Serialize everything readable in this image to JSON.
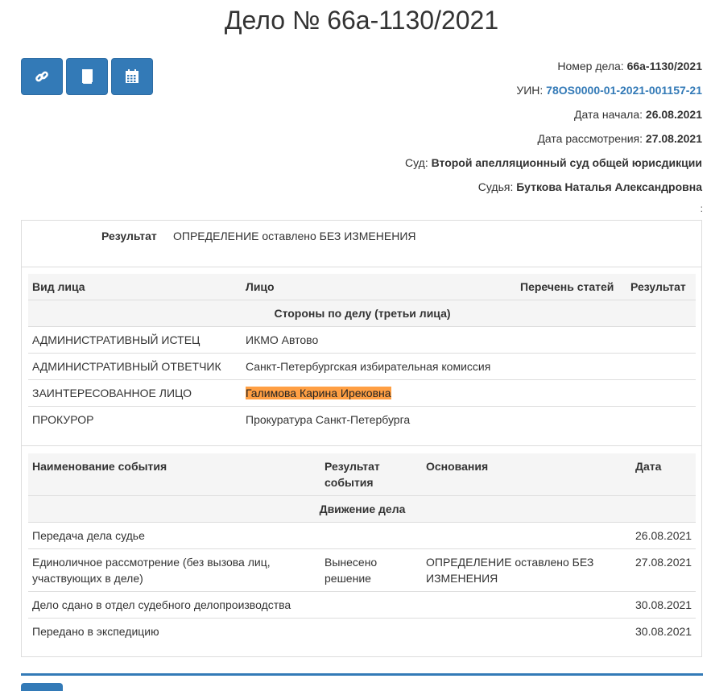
{
  "title": "Дело № 66а-1130/2021",
  "toolbar": {
    "buttons": [
      {
        "icon": "link-icon"
      },
      {
        "icon": "book-icon"
      },
      {
        "icon": "calendar-icon"
      }
    ]
  },
  "meta": {
    "case_number_label": "Номер дела:",
    "case_number": "66а-1130/2021",
    "uin_label": "УИН:",
    "uin": "78OS0000-01-2021-001157-21",
    "start_date_label": "Дата начала:",
    "start_date": "26.08.2021",
    "review_date_label": "Дата рассмотрения:",
    "review_date": "27.08.2021",
    "court_label": "Суд:",
    "court": "Второй апелляционный суд общей юрисдикции",
    "judge_label": "Судья:",
    "judge": "Буткова Наталья Александровна",
    "trailing": ":"
  },
  "result": {
    "label": "Результат",
    "value": "ОПРЕДЕЛЕНИЕ оставлено БЕЗ ИЗМЕНЕНИЯ"
  },
  "parties": {
    "caption": "Стороны по делу (третьи лица)",
    "columns": [
      "Вид лица",
      "Лицо",
      "Перечень статей",
      "Результат"
    ],
    "rows": [
      {
        "type": "АДМИНИСТРАТИВНЫЙ ИСТЕЦ",
        "person": "ИКМО Автово",
        "articles": "",
        "result": ""
      },
      {
        "type": "АДМИНИСТРАТИВНЫЙ ОТВЕТЧИК",
        "person": "Санкт-Петербургская избирательная комиссия",
        "articles": "",
        "result": ""
      },
      {
        "type": "ЗАИНТЕРЕСОВАННОЕ ЛИЦО",
        "person": "Галимова Карина Ирековна",
        "articles": "",
        "result": ""
      },
      {
        "type": "ПРОКУРОР",
        "person": "Прокуратура Санкт-Петербурга",
        "articles": "",
        "result": ""
      }
    ]
  },
  "movement": {
    "caption": "Движение дела",
    "columns": [
      "Наименование события",
      "Результат события",
      "Основания",
      "Дата"
    ],
    "rows": [
      {
        "event": "Передача дела судье",
        "result": "",
        "basis": "",
        "date": "26.08.2021"
      },
      {
        "event": "Единоличное рассмотрение (без вызова лиц, участвующих в деле)",
        "result": "Вынесено решение",
        "basis": "ОПРЕДЕЛЕНИЕ оставлено БЕЗ ИЗМЕНЕНИЯ",
        "date": "27.08.2021"
      },
      {
        "event": "Дело сдано в отдел судебного делопроизводства",
        "result": "",
        "basis": "",
        "date": "30.08.2021"
      },
      {
        "event": "Передано в экспедицию",
        "result": "",
        "basis": "",
        "date": "30.08.2021"
      }
    ]
  },
  "colors": {
    "accent": "#337ab7",
    "highlight": "#ff9f43"
  }
}
